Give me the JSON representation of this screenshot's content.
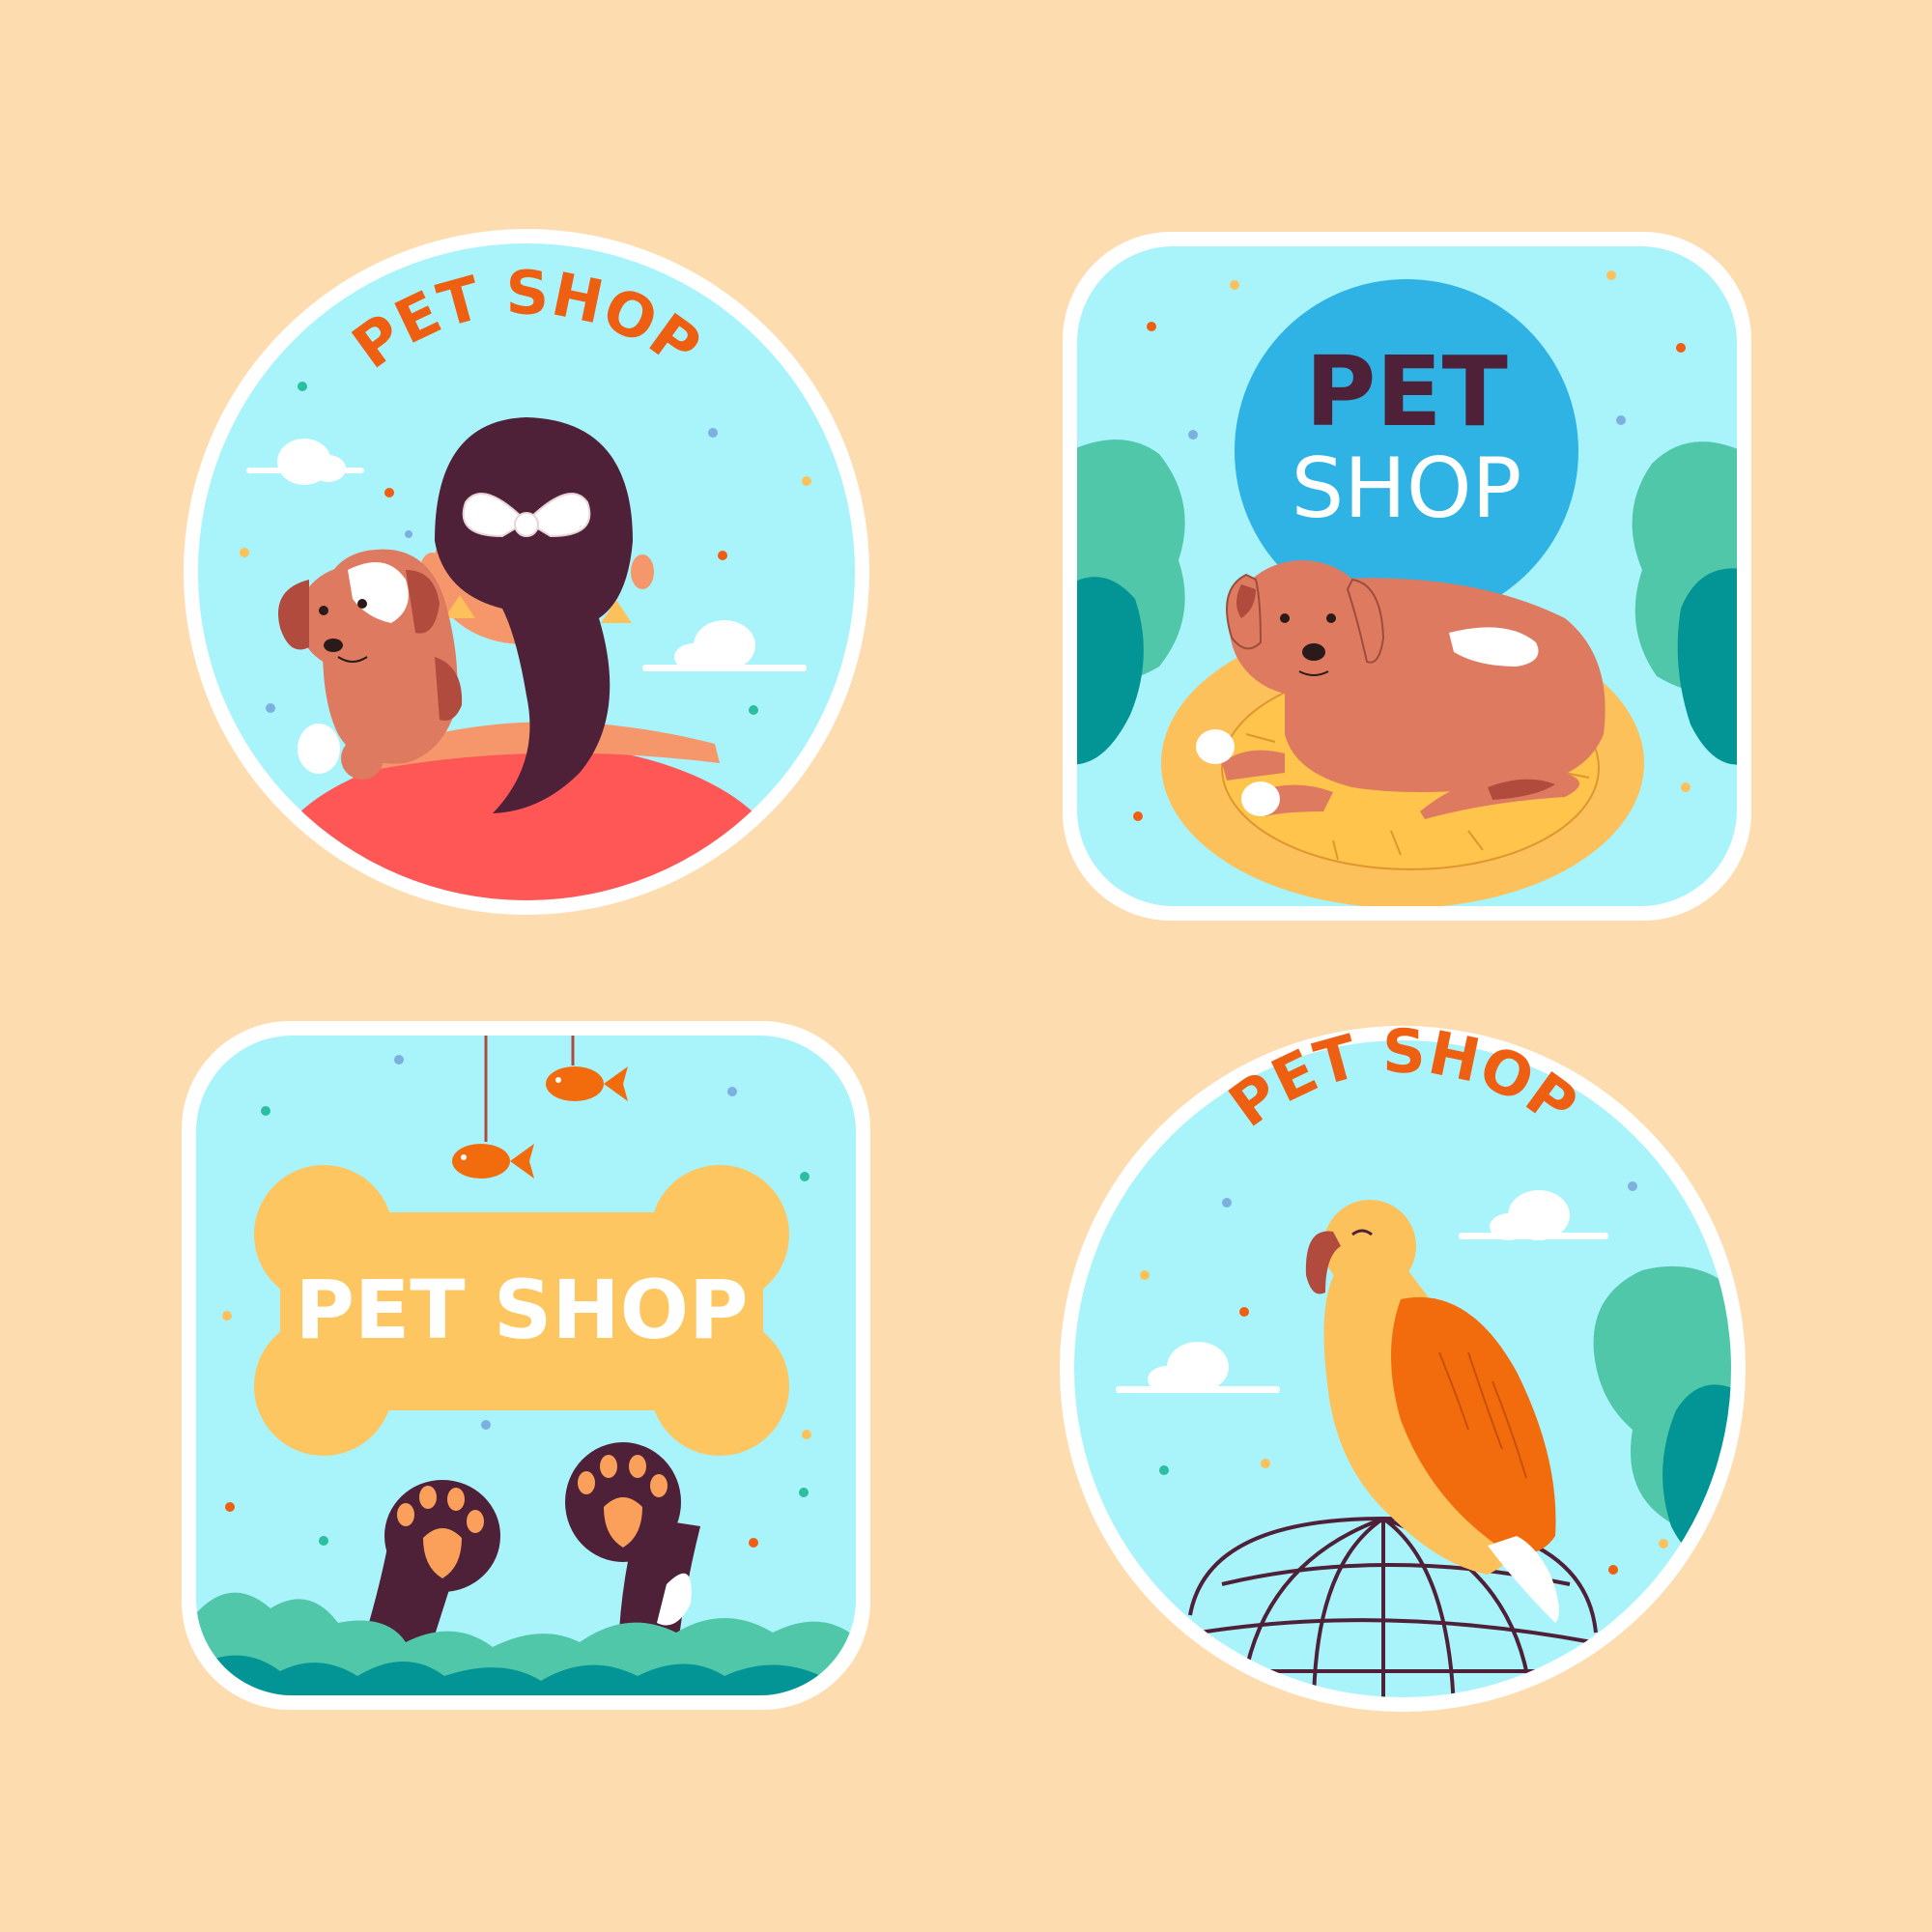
{
  "colors": {
    "background": "#FDDDB0",
    "badge_fill": "#A9F3FA",
    "badge_border": "#FFFFFF",
    "title_orange": "#EE5F12",
    "title_dark": "#4E2139",
    "blue_circle": "#2FB3E4",
    "bone": "#FEC660",
    "bush_light": "#51C7A9",
    "bush_dark": "#039595",
    "dog_body": "#DE7A60",
    "shirt": "#FF5656",
    "parrot_yellow": "#FDC15B",
    "parrot_wing": "#F26C0E"
  },
  "badges": [
    {
      "shape": "circle",
      "title": "PET SHOP",
      "title_color": "#EE5F12",
      "scene": "girl-with-puppy-on-shoulder"
    },
    {
      "shape": "rounded-square",
      "title_line1": "PET",
      "title_line2": "SHOP",
      "title_line1_color": "#4E2139",
      "title_line2_color": "#FFFFFF",
      "scene": "dog-lying-on-bed"
    },
    {
      "shape": "rounded-square",
      "title": "PET SHOP",
      "title_color": "#FFFFFF",
      "scene": "bone-sign-with-paws",
      "icons": [
        "bone-icon",
        "fish-toy-icon",
        "paw-icon"
      ]
    },
    {
      "shape": "circle",
      "title": "PET SHOP",
      "title_color": "#EE5F12",
      "scene": "parrot-on-cage"
    }
  ]
}
